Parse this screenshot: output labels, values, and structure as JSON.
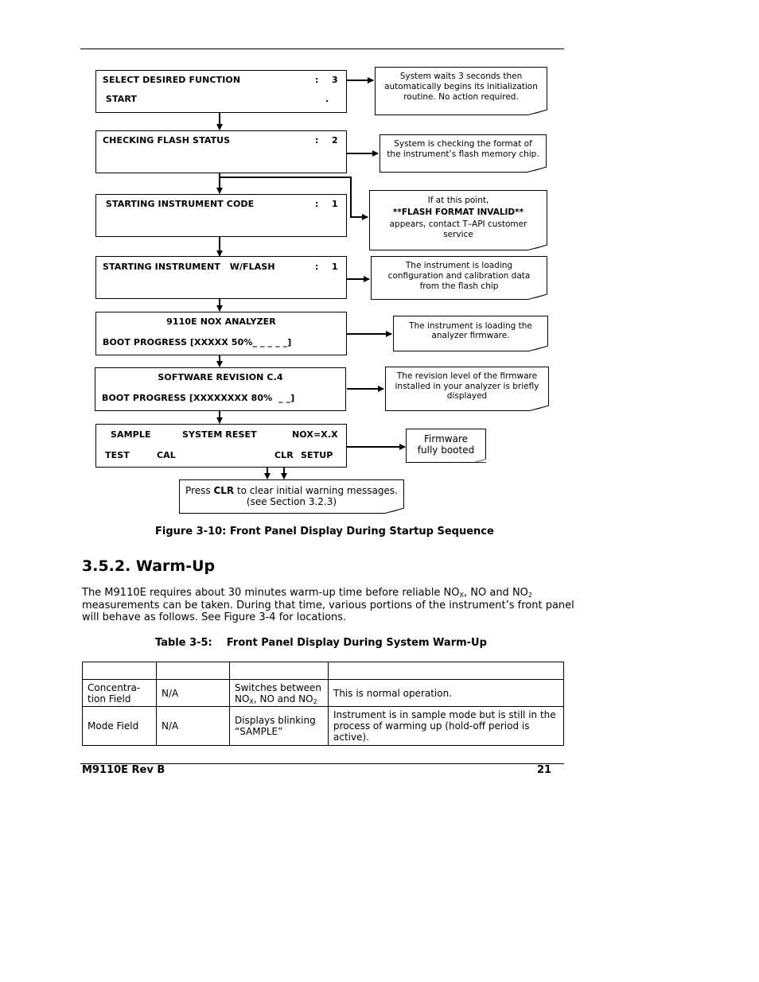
{
  "figure": {
    "panels": [
      {
        "line1_left": "SELECT DESIRED FUNCTION",
        "line1_colon": ":",
        "line1_value": "3",
        "line2_left": " START",
        "line2_value": "."
      },
      {
        "line1_left": "CHECKING FLASH STATUS",
        "line1_colon": ":",
        "line1_value": "2"
      },
      {
        "line1_left": " STARTING INSTRUMENT CODE",
        "line1_colon": ":",
        "line1_value": "1"
      },
      {
        "line1_left": "STARTING INSTRUMENT   W/FLASH",
        "line1_colon": ":",
        "line1_value": "1"
      },
      {
        "line1_center": "9110E NOX ANALYZER",
        "line2_left": "BOOT PROGRESS [XXXXX 50%_ _ _ _ _]"
      },
      {
        "line1_center": "SOFTWARE REVISION C.4",
        "line2_left": "BOOT PROGRESS [XXXXXXXX 80%  _ _]"
      },
      {
        "sample": "SAMPLE",
        "system_reset": "SYSTEM RESET",
        "nox": "NOX=X.X",
        "test": "TEST",
        "cal": "CAL",
        "clr": "CLR",
        "setup": "SETUP"
      }
    ],
    "notes": [
      {
        "lines": [
          "System waits 3 seconds then",
          "automatically begins its initialization",
          "routine. No action required."
        ]
      },
      {
        "lines": [
          "System is checking the format of",
          "the instrument’s flash memory chip."
        ]
      },
      {
        "line1": "If at this point,",
        "line2_bold": "**FLASH FORMAT INVALID**",
        "line3": "appears, contact T–API customer",
        "line4": "service"
      },
      {
        "lines": [
          "The instrument is loading",
          "configuration and calibration data",
          "from  the flash chip"
        ]
      },
      {
        "lines": [
          "The instrument is loading the",
          "analyzer firmware."
        ]
      },
      {
        "lines": [
          "The revision level of the firmware",
          "installed in your analyzer is briefly",
          "displayed"
        ]
      },
      {
        "lines": [
          "Firmware",
          "fully booted"
        ]
      },
      {
        "pre": "Press ",
        "bold": "CLR",
        "post": " to clear initial warning messages.",
        "line2": "(see Section 3.2.3)"
      }
    ],
    "caption": "Figure 3-10: Front Panel Display During Startup Sequence"
  },
  "section": {
    "heading": "3.5.2. Warm-Up",
    "para": {
      "p1": "The M9110E requires about 30 minutes warm-up time before reliable NO",
      "sub_x": "X",
      "p2": ", NO and NO",
      "sub_2": "2",
      "p3": "measurements can be taken. During that time, various portions of the instrument’s front panel will behave as follows. See Figure 3-4 for locations."
    },
    "table_caption": "Table 3-5:    Front Panel Display During System Warm-Up",
    "table": {
      "header": [
        "",
        "",
        "",
        ""
      ],
      "rows": [
        {
          "c1": "Concentra-tion Field",
          "c2": "N/A",
          "c3a": "Switches between NO",
          "c3sub": "X",
          "c3b": ", NO and NO",
          "c3sub2": "2",
          "c4": "This is normal operation."
        },
        {
          "c1": "Mode Field",
          "c2": "N/A",
          "c3": "Displays blinking “SAMPLE”",
          "c4": "Instrument is in sample mode but is still in the process of warming up (hold-off period is active)."
        }
      ]
    }
  },
  "footer": {
    "doc": "M9110E Rev B",
    "page": "21"
  }
}
